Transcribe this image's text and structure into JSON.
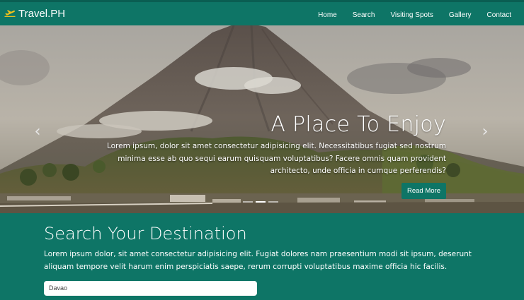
{
  "brand": {
    "name": "Travel.PH",
    "icon": "airplane-icon"
  },
  "nav": {
    "items": [
      {
        "label": "Home"
      },
      {
        "label": "Search"
      },
      {
        "label": "Visiting Spots"
      },
      {
        "label": "Gallery"
      },
      {
        "label": "Contact"
      }
    ]
  },
  "hero": {
    "title": "A Place To Enjoy",
    "text": "Lorem ipsum, dolor sit amet consectetur adipisicing elit. Necessitatibus fugiat sed nostrum minima esse ab quo sequi earum quisquam voluptatibus? Facere omnis quam provident architecto, unde officia in cumque perferendis?",
    "button_label": "Read More",
    "prev_icon": "chevron-left-icon",
    "next_icon": "chevron-right-icon",
    "slides_count": 3,
    "active_slide": 1
  },
  "search": {
    "title": "Search Your Destination",
    "description": "Lorem ipsum dolor, sit amet consectetur adipisicing elit. Fugiat dolores nam praesentium modi sit ipsum, deserunt aliquam tempore velit harum enim perspiciatis saepe, rerum corrupti voluptatibus maxime officia hic facilis.",
    "input_value": "Davao"
  },
  "colors": {
    "primary": "#0e7566",
    "text": "#ffffff",
    "brand_icon": "#f2c21b"
  }
}
